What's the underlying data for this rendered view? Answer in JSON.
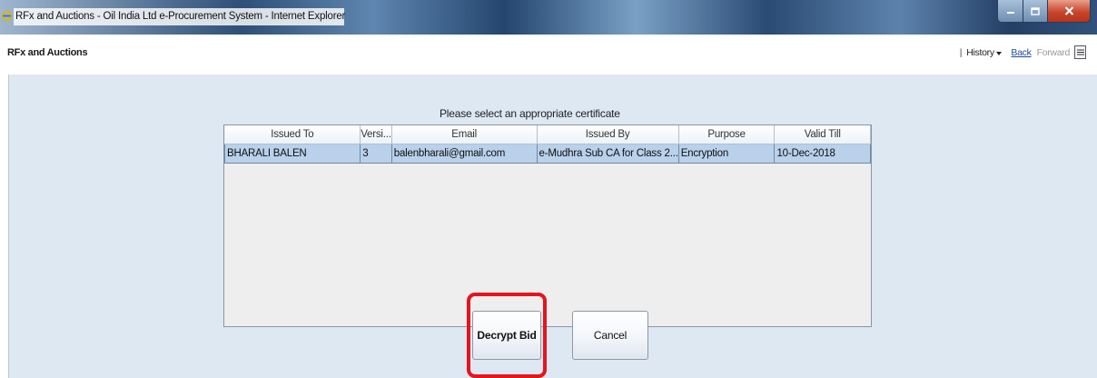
{
  "window": {
    "title": "RFx and Auctions - Oil India Ltd e-Procurement System - Internet Explorer"
  },
  "toolbar": {
    "app_label": "RFx and Auctions",
    "separator": "|",
    "history": "History",
    "back": "Back",
    "forward": "Forward"
  },
  "dialog": {
    "title": "Please select an appropriate certificate",
    "columns": [
      "Issued To",
      "Versi...",
      "Email",
      "Issued By",
      "Purpose",
      "Valid Till"
    ],
    "rows": [
      {
        "issued_to": "BHARALI BALEN",
        "version": "3",
        "email": "balenbharali@gmail.com",
        "issued_by": "e-Mudhra Sub CA for Class 2...",
        "purpose": "Encryption",
        "valid_till": "10-Dec-2018"
      }
    ],
    "decrypt_label": "Decrypt Bid",
    "cancel_label": "Cancel"
  },
  "colors": {
    "highlight": "#e5141f",
    "selected_row": "#b9d1ea",
    "panel_background": "#dde8f3"
  },
  "icons": [
    "ie-logo-icon",
    "minimize-icon",
    "maximize-icon",
    "close-icon",
    "dropdown-arrow-icon",
    "menu-icon"
  ]
}
